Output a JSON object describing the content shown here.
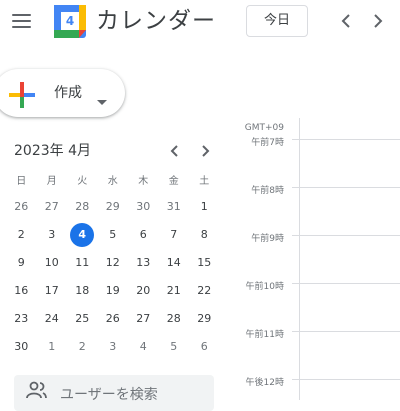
{
  "header": {
    "menu_icon": "hamburger-menu-icon",
    "logo_day": "4",
    "app_title": "カレンダー",
    "today_label": "今日",
    "prev_icon": "chevron-left-icon",
    "next_icon": "chevron-right-icon"
  },
  "create": {
    "label": "作成",
    "icon": "multicolor-plus-icon",
    "dropdown_icon": "caret-down-icon"
  },
  "mini_calendar": {
    "title": "2023年 4月",
    "weekdays": [
      "日",
      "月",
      "火",
      "水",
      "木",
      "金",
      "土"
    ],
    "weeks": [
      [
        {
          "d": "26",
          "other": true
        },
        {
          "d": "27",
          "other": true
        },
        {
          "d": "28",
          "other": true
        },
        {
          "d": "29",
          "other": true
        },
        {
          "d": "30",
          "other": true
        },
        {
          "d": "31",
          "other": true
        },
        {
          "d": "1"
        }
      ],
      [
        {
          "d": "2"
        },
        {
          "d": "3"
        },
        {
          "d": "4",
          "today": true
        },
        {
          "d": "5"
        },
        {
          "d": "6"
        },
        {
          "d": "7"
        },
        {
          "d": "8"
        }
      ],
      [
        {
          "d": "9"
        },
        {
          "d": "10"
        },
        {
          "d": "11"
        },
        {
          "d": "12"
        },
        {
          "d": "13"
        },
        {
          "d": "14"
        },
        {
          "d": "15"
        }
      ],
      [
        {
          "d": "16"
        },
        {
          "d": "17"
        },
        {
          "d": "18"
        },
        {
          "d": "19"
        },
        {
          "d": "20"
        },
        {
          "d": "21"
        },
        {
          "d": "22"
        }
      ],
      [
        {
          "d": "23"
        },
        {
          "d": "24"
        },
        {
          "d": "25"
        },
        {
          "d": "26"
        },
        {
          "d": "27"
        },
        {
          "d": "28"
        },
        {
          "d": "29"
        }
      ],
      [
        {
          "d": "30"
        },
        {
          "d": "1",
          "other": true
        },
        {
          "d": "2",
          "other": true
        },
        {
          "d": "3",
          "other": true
        },
        {
          "d": "4",
          "other": true
        },
        {
          "d": "5",
          "other": true
        },
        {
          "d": "6",
          "other": true
        }
      ]
    ]
  },
  "search": {
    "placeholder": "ユーザーを検索",
    "icon": "people-icon"
  },
  "timeline": {
    "timezone": "GMT+09",
    "hours": [
      "午前7時",
      "午前8時",
      "午前9時",
      "午前10時",
      "午前11時",
      "午後12時"
    ]
  },
  "colors": {
    "accent": "#1a73e8",
    "text": "#3c4043",
    "muted": "#70757a",
    "border": "#dadce0"
  }
}
